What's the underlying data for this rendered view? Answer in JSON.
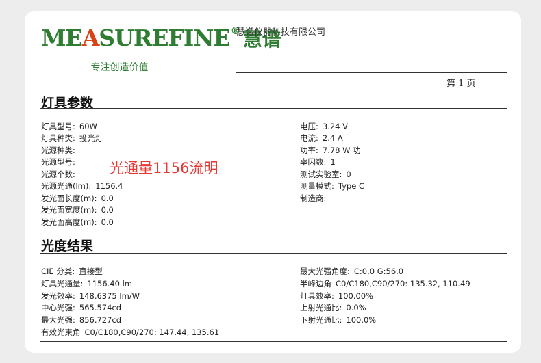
{
  "header": {
    "logo_part1": "ME",
    "logo_part2": "A",
    "logo_part3": "SUREFINE",
    "logo_reg": "®",
    "logo_cn": "慧谱",
    "logo_slogan": "专注创造价值",
    "company": "慧谱仪器科技有限公司",
    "page_label": "第 1 页"
  },
  "lamp_params": {
    "title": "灯具参数",
    "left": [
      {
        "label": "灯具型号:",
        "value": "60W"
      },
      {
        "label": "灯具种类:",
        "value": "投光灯"
      },
      {
        "label": "光源种类:",
        "value": ""
      },
      {
        "label": "光源型号:",
        "value": ""
      },
      {
        "label": "光源个数:",
        "value": ""
      },
      {
        "label": "光源光通(lm):",
        "value": "1156.4"
      },
      {
        "label": "发光面长度(m):",
        "value": "0.0"
      },
      {
        "label": "发光面宽度(m):",
        "value": "0.0"
      },
      {
        "label": "发光面高度(m):",
        "value": "0.0"
      }
    ],
    "right": [
      {
        "label": "电压:",
        "value": "3.24 V"
      },
      {
        "label": "电流:",
        "value": "2.4  A"
      },
      {
        "label": "功率:",
        "value": "7.78 W  功"
      },
      {
        "label": "率因数:",
        "value": "1"
      },
      {
        "label": "测试实验室:",
        "value": "0"
      },
      {
        "label": "测量模式:",
        "value": "Type C"
      },
      {
        "label": "制造商:",
        "value": ""
      }
    ]
  },
  "overlay_text": "光通量1156流明",
  "results": {
    "title": "光度结果",
    "left": [
      {
        "label": "CIE 分类:",
        "value": "直接型"
      },
      {
        "label": "灯具光通量:",
        "value": "1156.40 lm"
      },
      {
        "label": "发光效率:",
        "value": "148.6375 lm/W"
      },
      {
        "label": "中心光强:",
        "value": "565.574cd"
      },
      {
        "label": "最大光强:",
        "value": "856.727cd"
      },
      {
        "label": "有效光束角",
        "value": "C0/C180,C90/270: 147.44, 135.61"
      }
    ],
    "right": [
      {
        "label": "最大光强角度:",
        "value": "C:0.0  G:56.0"
      },
      {
        "label": "半峰边角",
        "value": "C0/C180,C90/270: 135.32, 110.49"
      },
      {
        "label": "灯具效率:",
        "value": "100.00%"
      },
      {
        "label": "上射光通比:",
        "value": "0.0%"
      },
      {
        "label": "下射光通比:",
        "value": "100.0%"
      }
    ]
  }
}
